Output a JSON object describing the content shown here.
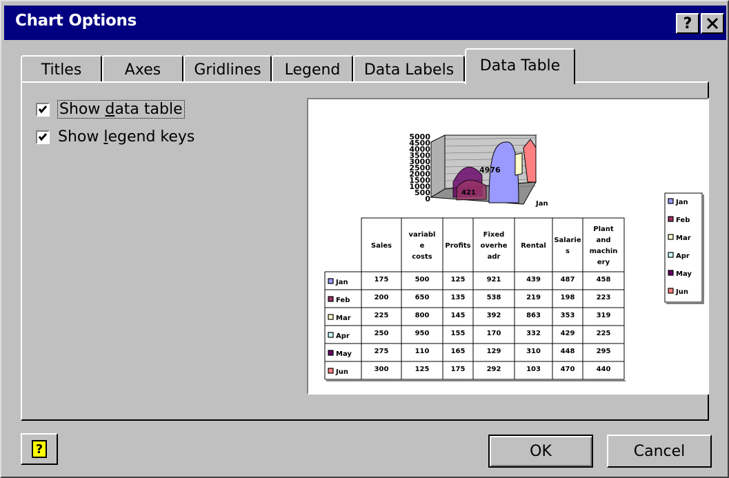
{
  "window": {
    "title": "Chart Options",
    "help_glyph": "?",
    "close_glyph": "✕"
  },
  "tabs": [
    {
      "label": "Titles"
    },
    {
      "label": "Axes"
    },
    {
      "label": "Gridlines"
    },
    {
      "label": "Legend"
    },
    {
      "label": "Data Labels"
    },
    {
      "label": "Data Table",
      "active": true
    }
  ],
  "options": {
    "show_data_table": {
      "label_pre": "Show ",
      "label_key": "d",
      "label_post": "ata table",
      "checked": true
    },
    "show_legend_keys": {
      "label_pre": "Show ",
      "label_key": "l",
      "label_post": "egend keys",
      "checked": true
    }
  },
  "buttons": {
    "ok": "OK",
    "cancel": "Cancel",
    "help_icon": "?"
  },
  "chart_data": {
    "type": "table",
    "y_ticks": [
      "5000",
      "4500",
      "4000",
      "3500",
      "3000",
      "2500",
      "2000",
      "1500",
      "1000",
      "500",
      "0"
    ],
    "x_axis_label": "Jan",
    "inner_labels": [
      "4976",
      "421"
    ],
    "columns": [
      "Sales",
      "variabl e costs",
      "Profits",
      "Fixed overhe adr",
      "Rental",
      "Salarie s",
      "Plant and machin ery"
    ],
    "rows": [
      {
        "name": "Jan",
        "color": "#9999ff",
        "values": [
          175,
          500,
          125,
          921,
          439,
          487,
          458
        ]
      },
      {
        "name": "Feb",
        "color": "#993366",
        "values": [
          200,
          650,
          135,
          538,
          219,
          198,
          223
        ]
      },
      {
        "name": "Mar",
        "color": "#ffffcc",
        "values": [
          225,
          800,
          145,
          392,
          863,
          353,
          319
        ]
      },
      {
        "name": "Apr",
        "color": "#ccffff",
        "values": [
          250,
          950,
          155,
          170,
          332,
          429,
          225
        ]
      },
      {
        "name": "May",
        "color": "#660066",
        "values": [
          275,
          110,
          165,
          129,
          310,
          448,
          295
        ]
      },
      {
        "name": "Jun",
        "color": "#ff8080",
        "values": [
          300,
          125,
          175,
          292,
          103,
          470,
          440
        ]
      }
    ],
    "legend": [
      "Jan",
      "Feb",
      "Mar",
      "Apr",
      "May",
      "Jun"
    ]
  }
}
